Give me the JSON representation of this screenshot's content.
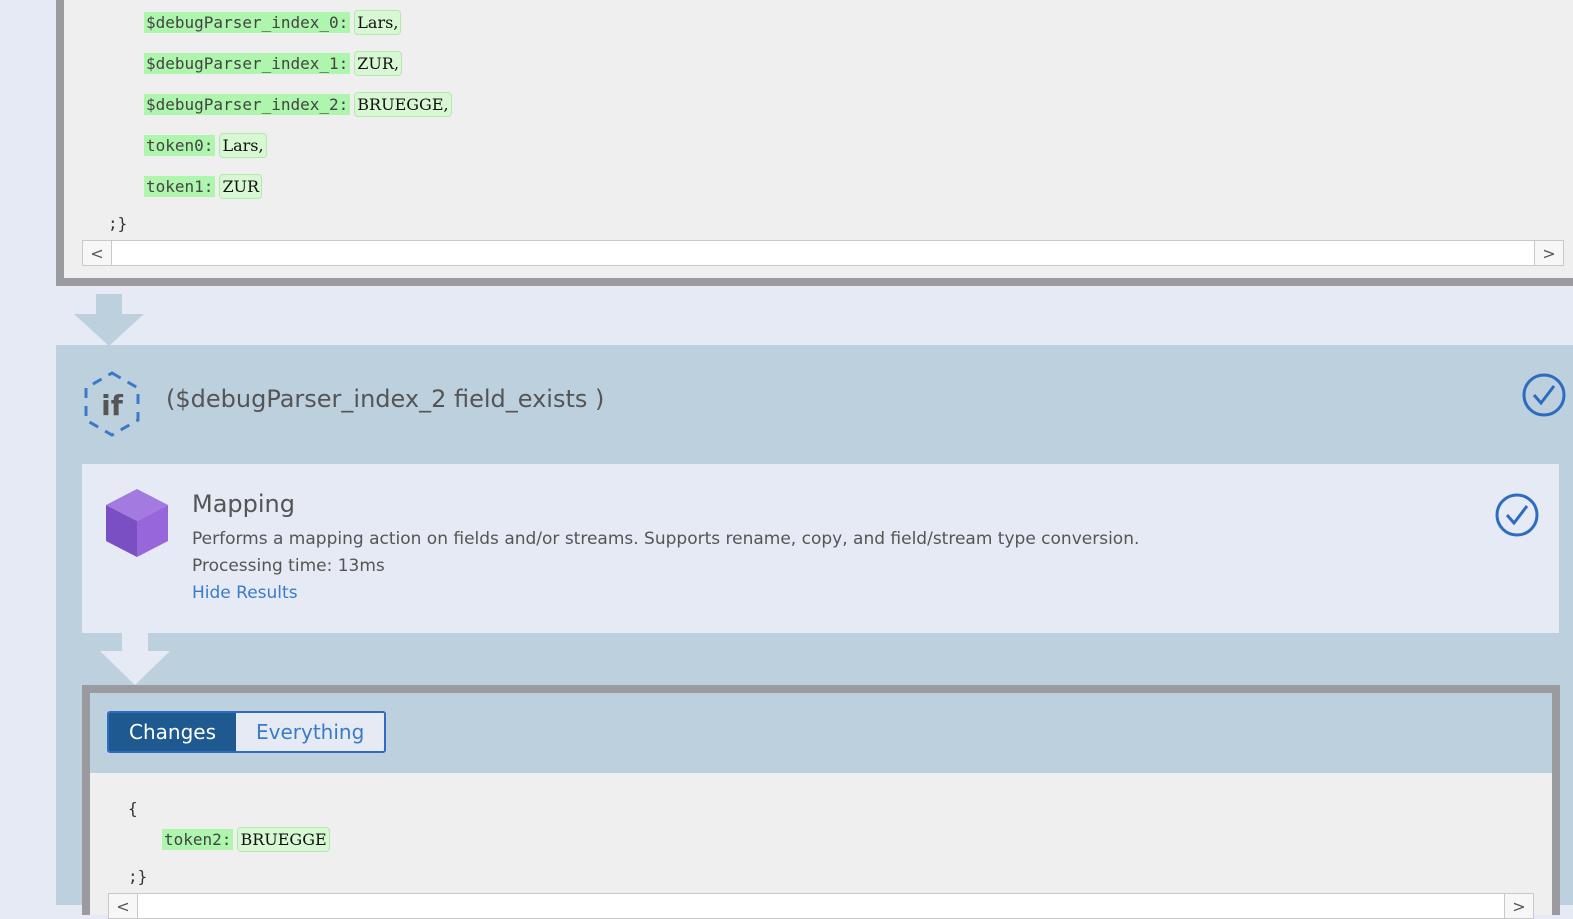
{
  "top_result": {
    "open_brace": "{",
    "fields": [
      {
        "key": "$debugParser_index_0:",
        "value": "Lars,"
      },
      {
        "key": "$debugParser_index_1:",
        "value": "ZUR,"
      },
      {
        "key": "$debugParser_index_2:",
        "value": "BRUEGGE,"
      },
      {
        "key": "token0:",
        "value": "Lars,"
      },
      {
        "key": "token1:",
        "value": "ZUR"
      }
    ],
    "close": ";}",
    "scroll_left": "<",
    "scroll_right": ">"
  },
  "if_step": {
    "icon": "if-hexagon-icon",
    "condition": "($debugParser_index_2 field_exists )",
    "status_icon": "check-circle-icon"
  },
  "mapping_step": {
    "icon": "purple-cube-icon",
    "title": "Mapping",
    "description": "Performs a mapping action on fields and/or streams. Supports rename, copy, and field/stream type conversion.",
    "processing_time": "Processing time: 13ms",
    "toggle_link": "Hide Results",
    "status_icon": "check-circle-icon"
  },
  "results": {
    "tabs": [
      {
        "label": "Changes",
        "active": true
      },
      {
        "label": "Everything",
        "active": false
      }
    ],
    "open_brace": "{",
    "fields": [
      {
        "key": "token2:",
        "value": "BRUEGGE"
      }
    ],
    "close": ";}",
    "scroll_left": "<",
    "scroll_right": ">"
  },
  "colors": {
    "key_bg": "#aef5ad",
    "value_bg": "#d8f8d4",
    "accent_blue": "#3a7bc8",
    "active_tab": "#1e5a8f",
    "cube_purple": "#8a5fd0"
  }
}
